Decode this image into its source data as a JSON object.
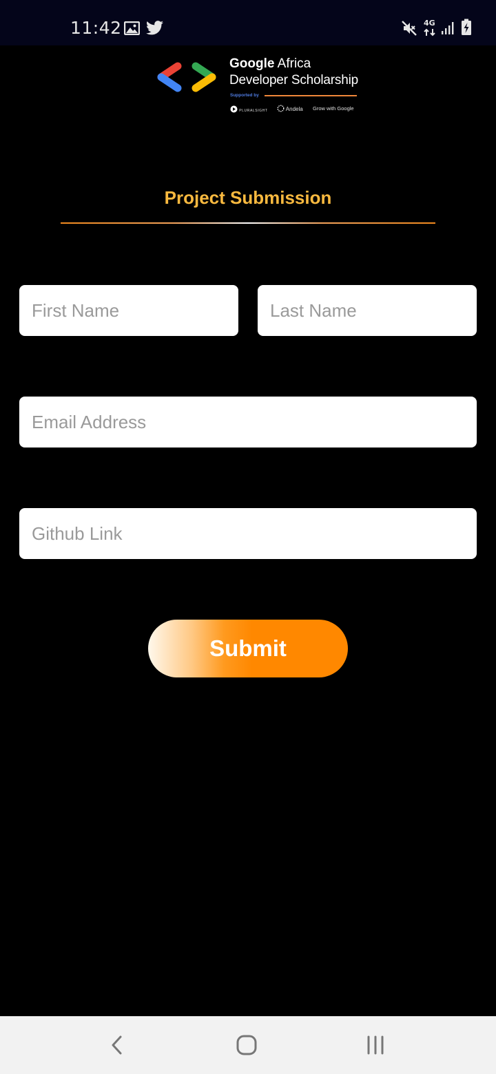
{
  "status_bar": {
    "time": "11:42",
    "network": "4G",
    "icons": [
      "image-icon",
      "twitter-icon",
      "mute-icon",
      "data-arrows-icon",
      "signal-icon",
      "battery-charging-icon"
    ]
  },
  "brand": {
    "title_bold": "Google",
    "title_rest": " Africa",
    "subtitle": "Developer Scholarship",
    "supported_by": "Supported by",
    "partners": [
      "PLURALSIGHT",
      "Andela",
      "Grow with Google"
    ],
    "colors": {
      "red": "#ea4335",
      "blue": "#4285f4",
      "green": "#34a853",
      "yellow": "#fbbc05"
    }
  },
  "page": {
    "title": "Project Submission",
    "accent_color": "#f9b93f"
  },
  "form": {
    "first_name": {
      "placeholder": "First Name",
      "value": ""
    },
    "last_name": {
      "placeholder": "Last Name",
      "value": ""
    },
    "email": {
      "placeholder": "Email Address",
      "value": ""
    },
    "github": {
      "placeholder": "Github Link",
      "value": ""
    },
    "submit_label": "Submit",
    "submit_color": "#ff8800"
  },
  "nav_bar": {
    "buttons": [
      "back-icon",
      "home-icon",
      "recents-icon"
    ]
  }
}
